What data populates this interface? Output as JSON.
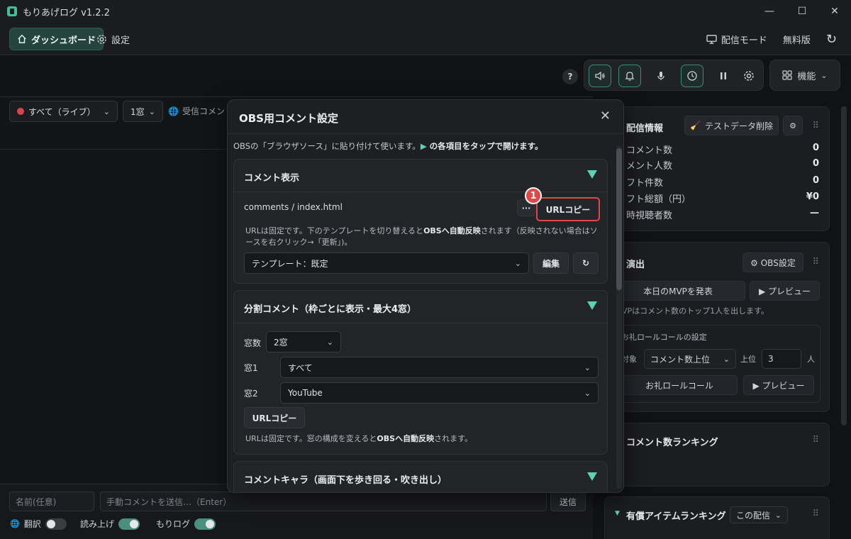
{
  "window": {
    "title": "もりあげログ  v1.2.2",
    "minimize": "—",
    "maximize": "☐",
    "close": "✕"
  },
  "nav": {
    "dashboard": "ダッシュボード",
    "settings": "設定",
    "stream_mode": "配信モード",
    "free_plan": "無料版",
    "reload": "↻"
  },
  "toolbar": {
    "help": "?",
    "features": "機能"
  },
  "left": {
    "source_filter": "すべて（ライブ）",
    "window_count": "1窓",
    "receive_label": "受信コメン"
  },
  "bottom": {
    "name_placeholder": "名前(任意)",
    "message_placeholder": "手動コメントを送信…（Enter）",
    "send": "送信",
    "translate": "翻訳",
    "read_aloud": "読み上げ",
    "morilog": "もりログ"
  },
  "right": {
    "stream_info": {
      "title": "配信情報",
      "clear_test": "テストデータ削除",
      "stats": [
        {
          "label": "コメント数",
          "value": "0"
        },
        {
          "label": "メント人数",
          "value": "0"
        },
        {
          "label": "フト件数",
          "value": "0"
        },
        {
          "label": "フト総額（円）",
          "value": "¥0"
        },
        {
          "label": "時視聴者数",
          "value": "—"
        }
      ]
    },
    "effects": {
      "title": "演出",
      "obs_settings": "⚙ OBS設定",
      "mvp_button": "本日のMVPを発表",
      "preview1": "▶ プレビュー",
      "mvp_note": "VPはコメント数のトップ1人を出します。",
      "roll_title": "お礼ロールコールの設定",
      "target_label": "対象",
      "target_value": "コメント数上位",
      "top_label": "上位",
      "top_value": "3",
      "people_label": "人",
      "roll_button": "お礼ロールコール",
      "preview2": "▶ プレビュー"
    },
    "ranking": {
      "title": "コメント数ランキング"
    },
    "paid": {
      "title": "有償アイテムランキング",
      "scope": "この配信"
    }
  },
  "modal": {
    "title": "OBS用コメント設定",
    "intro_a": "OBSの「ブラウザソース」に貼り付けて使います。",
    "intro_b": "▶",
    "intro_c": " の各項目をタップで開けます。",
    "sec1": {
      "title": "コメント表示",
      "path": "comments / index.html",
      "more": "···",
      "copy": "URLコピー",
      "step": "1",
      "note_a": "URLは固定です。下のテンプレートを切り替えると",
      "note_b": "OBSへ自動反映",
      "note_c": "されます（反映されない場合はソ",
      "note_d": "ースを右クリック→「更新」)。",
      "template": "テンプレート：既定",
      "edit": "編集",
      "refresh": "↻"
    },
    "sec2": {
      "title": "分割コメント（枠ごとに表示・最大4窓）",
      "count_label": "窓数",
      "count_value": "2窓",
      "w1_label": "窓1",
      "w1_value": "すべて",
      "w2_label": "窓2",
      "w2_value": "YouTube",
      "copy": "URLコピー",
      "note_a": "URLは固定です。窓の構成を変えると",
      "note_b": "OBSへ自動反映",
      "note_c": "されます。"
    },
    "sec3": {
      "title": "コメントキャラ（画面下を歩き回る・吹き出し）"
    }
  },
  "icons": {
    "home": "home-icon",
    "gear": "gear-icon",
    "monitor": "monitor-icon",
    "speaker": "speaker-icon",
    "bell": "bell-icon",
    "mic": "mic-icon",
    "clock": "clock-icon",
    "pause": "pause-icon",
    "grid": "grid-icon"
  },
  "colors": {
    "accent": "#5fd0b6",
    "highlight": "#e04848"
  }
}
